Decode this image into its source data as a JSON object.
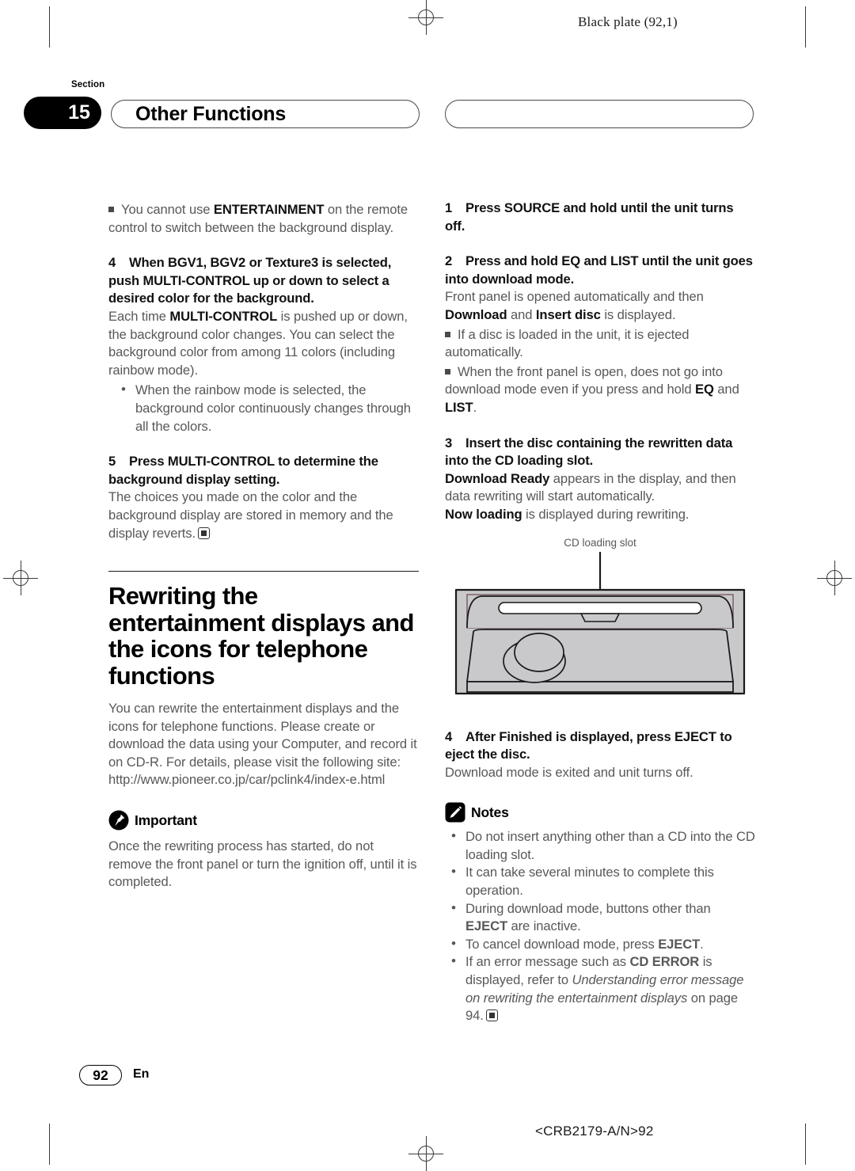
{
  "plate": {
    "header_label": "Black plate (92,1)",
    "footer_code": "<CRB2179-A/N>92"
  },
  "section": {
    "word": "Section",
    "number": "15",
    "title": "Other Functions",
    "right_pill_title": ""
  },
  "left_column": {
    "note_top": {
      "text_1": "You cannot use ",
      "bold_1": "ENTERTAINMENT",
      "text_2": " on the remote control to switch between the background display."
    },
    "step4": {
      "num": "4",
      "head": "When BGV1, BGV2 or Texture3 is selected, push MULTI-CONTROL up or down to select a desired color for the background.",
      "body_1": "Each time ",
      "body_bold": "MULTI-CONTROL",
      "body_2": " is pushed up or down, the background color changes. You can select the background color from among 11 colors (including rainbow mode).",
      "sub_bullets": [
        "When the rainbow mode is selected, the background color continuously changes through all the colors."
      ]
    },
    "step5": {
      "num": "5",
      "head": "Press MULTI-CONTROL to determine the background display setting.",
      "body": "The choices you made on the color and the background display are stored in memory and the display reverts."
    },
    "heading": "Rewriting the entertainment displays and the icons for telephone functions",
    "intro": "You can rewrite the entertainment displays and the icons for telephone functions. Please create or download the data using your Computer, and record it on CD-R. For details, please visit the following site:",
    "url": "http://www.pioneer.co.jp/car/pclink4/index-e.html",
    "important": {
      "icon": "pushpin-icon",
      "label": "Important",
      "body": "Once the rewriting process has started, do not remove the front panel or turn the ignition off, until it is completed."
    }
  },
  "right_column": {
    "step1": {
      "num": "1",
      "head": "Press SOURCE and hold until the unit turns off."
    },
    "step2": {
      "num": "2",
      "head": "Press and hold EQ and LIST until the unit goes into download mode.",
      "body_1": "Front panel is opened automatically and then ",
      "body_bold_1": "Download",
      "body_2": " and ",
      "body_bold_2": "Insert disc",
      "body_3": " is displayed.",
      "notes": [
        {
          "text_1": "If a disc is loaded in the unit, it is ejected automatically.",
          "bold": "",
          "text_2": ""
        },
        {
          "text_1": "When the front panel is open, does not go into download mode even if you press and hold ",
          "bold": "EQ",
          "text_2": " and ",
          "bold_2": "LIST",
          "text_3": "."
        }
      ]
    },
    "step3": {
      "num": "3",
      "head": "Insert the disc containing the rewritten data into the CD loading slot.",
      "body_bold_1": "Download Ready",
      "body_1": " appears in the display, and then data rewriting will start automatically.",
      "body_bold_2": "Now loading",
      "body_2": " is displayed during rewriting."
    },
    "figure": {
      "caption": "CD loading slot",
      "alt": "car-stereo-front-panel-illustration"
    },
    "step4": {
      "num": "4",
      "head": "After Finished is displayed, press EJECT to eject the disc.",
      "body": "Download mode is exited and unit turns off."
    },
    "notes_block": {
      "icon": "pencil-icon",
      "label": "Notes",
      "items": [
        {
          "t1": "Do not insert anything other than a CD into the CD loading slot."
        },
        {
          "t1": "It can take several minutes to complete this operation."
        },
        {
          "t1": "During download mode, buttons other than ",
          "b1": "EJECT",
          "t2": " are inactive."
        },
        {
          "t1": "To cancel download mode, press ",
          "b1": "EJECT",
          "t2": "."
        },
        {
          "t1": "If an error message such as ",
          "b1": "CD ERROR",
          "t2": " is displayed, refer to ",
          "i1": "Understanding error message on rewriting the entertainment displays",
          "t3": " on page 94."
        }
      ]
    }
  },
  "footer": {
    "page_number": "92",
    "language": "En"
  },
  "colors": {
    "body_text": "#58585a",
    "heading_text": "#000000",
    "unit_fill": "#c9c9cb",
    "rule": "#1a1a1a"
  }
}
